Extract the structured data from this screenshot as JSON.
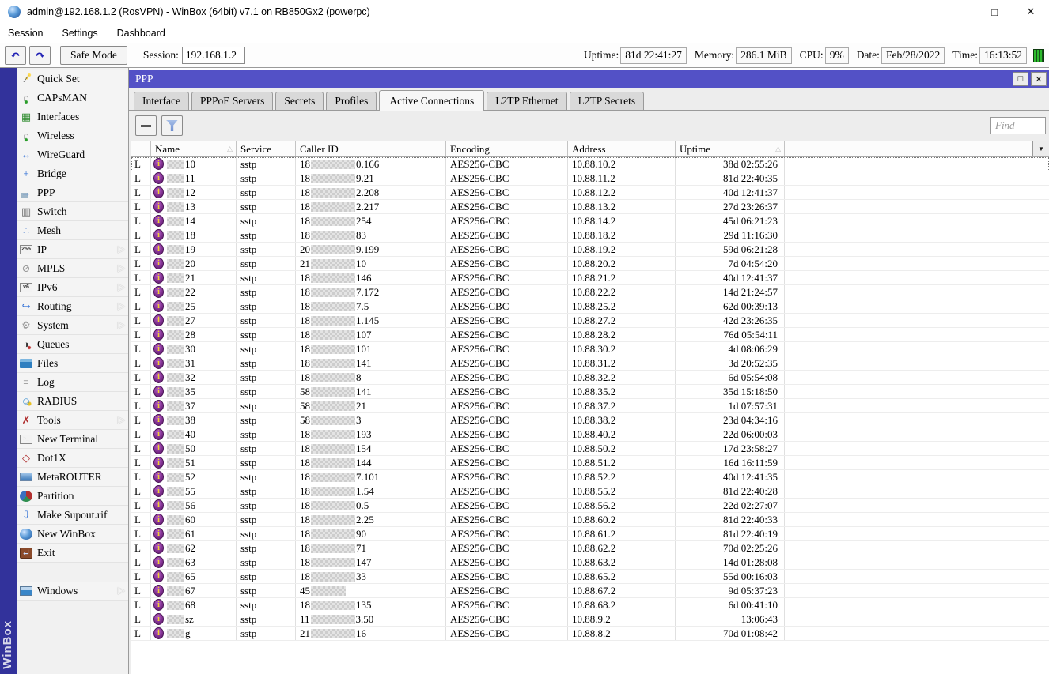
{
  "window": {
    "title": "admin@192.168.1.2 (RosVPN) - WinBox (64bit) v7.1 on RB850Gx2 (powerpc)",
    "controls": {
      "minimize": "–",
      "maximize": "□",
      "close": "✕"
    }
  },
  "menubar": {
    "items": [
      "Session",
      "Settings",
      "Dashboard"
    ]
  },
  "toolbar": {
    "undo_glyph": "↶",
    "redo_glyph": "↷",
    "safe_mode_label": "Safe Mode",
    "session_label": "Session:",
    "session_value": "192.168.1.2",
    "stats": [
      {
        "label": "Uptime:",
        "value": "81d 22:41:27"
      },
      {
        "label": "Memory:",
        "value": "286.1 MiB"
      },
      {
        "label": "CPU:",
        "value": "9%"
      },
      {
        "label": "Date:",
        "value": "Feb/28/2022"
      },
      {
        "label": "Time:",
        "value": "16:13:52"
      }
    ],
    "indicator_color": "#2dbb2d"
  },
  "sidebar": {
    "brand": "WinBox",
    "strip_color": "#32329b",
    "items": [
      {
        "label": "Quick Set",
        "icon": "wand-icon",
        "glyph": "∕",
        "color": "#444444",
        "arrow": false
      },
      {
        "label": "CAPsMAN",
        "icon": "antenna-icon",
        "glyph": "∩",
        "color": "#9a9a9a",
        "arrow": false
      },
      {
        "label": "Interfaces",
        "icon": "nic-icon",
        "glyph": "▦",
        "color": "#2e8b2e",
        "arrow": false
      },
      {
        "label": "Wireless",
        "icon": "antenna-icon",
        "glyph": "∩",
        "color": "#9a9a9a",
        "arrow": false
      },
      {
        "label": "WireGuard",
        "icon": "wireguard-icon",
        "glyph": "↔",
        "color": "#2f6fd6",
        "arrow": false
      },
      {
        "label": "Bridge",
        "icon": "bridge-icon",
        "glyph": "+",
        "color": "#2f6fd6",
        "arrow": false
      },
      {
        "label": "PPP",
        "icon": "ppp-icon",
        "glyph": "→",
        "color": "#2f6fd6",
        "arrow": false
      },
      {
        "label": "Switch",
        "icon": "switch-icon",
        "glyph": "▥",
        "color": "#666666",
        "arrow": false
      },
      {
        "label": "Mesh",
        "icon": "mesh-icon",
        "glyph": "∴",
        "color": "#4477cc",
        "arrow": false
      },
      {
        "label": "IP",
        "icon": "ip-icon",
        "glyph": "255",
        "color": "#333333",
        "boxed": true,
        "arrow": true
      },
      {
        "label": "MPLS",
        "icon": "mpls-icon",
        "glyph": "⊘",
        "color": "#999999",
        "arrow": true
      },
      {
        "label": "IPv6",
        "icon": "ipv6-icon",
        "glyph": "v6",
        "color": "#333333",
        "boxed": true,
        "arrow": true
      },
      {
        "label": "Routing",
        "icon": "routing-icon",
        "glyph": "↪",
        "color": "#2f6fd6",
        "arrow": true
      },
      {
        "label": "System",
        "icon": "system-icon",
        "glyph": "⚙",
        "color": "#9a9a9a",
        "arrow": true
      },
      {
        "label": "Queues",
        "icon": "queues-icon",
        "glyph": "◑",
        "color": "#333333",
        "arrow": false
      },
      {
        "label": "Files",
        "icon": "files-icon",
        "glyph": "",
        "color": "#2f7fc0",
        "arrow": false
      },
      {
        "label": "Log",
        "icon": "log-icon",
        "glyph": "≡",
        "color": "#777777",
        "arrow": false
      },
      {
        "label": "RADIUS",
        "icon": "radius-icon",
        "glyph": "☺",
        "color": "#3a8fd0",
        "arrow": false
      },
      {
        "label": "Tools",
        "icon": "tools-icon",
        "glyph": "✗",
        "color": "#b03030",
        "arrow": true
      },
      {
        "label": "New Terminal",
        "icon": "terminal-icon",
        "glyph": ">_",
        "color": "#e8e8e8",
        "boxed": true,
        "arrow": false
      },
      {
        "label": "Dot1X",
        "icon": "dot1x-icon",
        "glyph": "◇",
        "color": "#b03030",
        "arrow": false
      },
      {
        "label": "MetaROUTER",
        "icon": "metarouter-icon",
        "glyph": "",
        "color": "#3a78b8",
        "arrow": false
      },
      {
        "label": "Partition",
        "icon": "partition-icon",
        "glyph": "",
        "color": "#b23030",
        "arrow": false
      },
      {
        "label": "Make Supout.rif",
        "icon": "supout-icon",
        "glyph": "⇩",
        "color": "#2f6fd6",
        "arrow": false
      },
      {
        "label": "New WinBox",
        "icon": "winbox-icon",
        "glyph": "",
        "color": "#20549a",
        "arrow": false
      },
      {
        "label": "Exit",
        "icon": "exit-icon",
        "glyph": "↵",
        "color": "#cfe0ff",
        "arrow": false
      },
      {
        "spacer": true
      },
      {
        "label": "Windows",
        "icon": "windows-icon",
        "glyph": "",
        "color": "#3a86c8",
        "arrow": true
      }
    ]
  },
  "ppp": {
    "title": "PPP",
    "title_color": "#5351c6",
    "controls": {
      "maximize": "□",
      "close": "✕"
    },
    "tabs": [
      {
        "label": "Interface",
        "active": false
      },
      {
        "label": "PPPoE Servers",
        "active": false
      },
      {
        "label": "Secrets",
        "active": false
      },
      {
        "label": "Profiles",
        "active": false
      },
      {
        "label": "Active Connections",
        "active": true
      },
      {
        "label": "L2TP Ethernet",
        "active": false
      },
      {
        "label": "L2TP Secrets",
        "active": false
      }
    ],
    "find_placeholder": "Find",
    "table": {
      "headers": {
        "flag": "",
        "name": "Name",
        "service": "Service",
        "caller": "Caller ID",
        "encoding": "Encoding",
        "address": "Address",
        "uptime": "Uptime"
      },
      "sort_glyph": "△",
      "dropdown_glyph": "▼",
      "rows": [
        {
          "flag": "L",
          "name_suffix": "10",
          "service": "sstp",
          "caller_prefix": "18",
          "caller_suffix": "0.166",
          "encoding": "AES256-CBC",
          "address": "10.88.10.2",
          "uptime": "38d 02:55:26"
        },
        {
          "flag": "L",
          "name_suffix": "11",
          "service": "sstp",
          "caller_prefix": "18",
          "caller_suffix": "9.21",
          "encoding": "AES256-CBC",
          "address": "10.88.11.2",
          "uptime": "81d 22:40:35"
        },
        {
          "flag": "L",
          "name_suffix": "12",
          "service": "sstp",
          "caller_prefix": "18",
          "caller_suffix": "2.208",
          "encoding": "AES256-CBC",
          "address": "10.88.12.2",
          "uptime": "40d 12:41:37"
        },
        {
          "flag": "L",
          "name_suffix": "13",
          "service": "sstp",
          "caller_prefix": "18",
          "caller_suffix": "2.217",
          "encoding": "AES256-CBC",
          "address": "10.88.13.2",
          "uptime": "27d 23:26:37"
        },
        {
          "flag": "L",
          "name_suffix": "14",
          "service": "sstp",
          "caller_prefix": "18",
          "caller_suffix": "254",
          "encoding": "AES256-CBC",
          "address": "10.88.14.2",
          "uptime": "45d 06:21:23"
        },
        {
          "flag": "L",
          "name_suffix": "18",
          "service": "sstp",
          "caller_prefix": "18",
          "caller_suffix": "83",
          "encoding": "AES256-CBC",
          "address": "10.88.18.2",
          "uptime": "29d 11:16:30"
        },
        {
          "flag": "L",
          "name_suffix": "19",
          "service": "sstp",
          "caller_prefix": "20",
          "caller_suffix": "9.199",
          "encoding": "AES256-CBC",
          "address": "10.88.19.2",
          "uptime": "59d 06:21:28"
        },
        {
          "flag": "L",
          "name_suffix": "20",
          "service": "sstp",
          "caller_prefix": "21",
          "caller_suffix": "10",
          "encoding": "AES256-CBC",
          "address": "10.88.20.2",
          "uptime": "7d 04:54:20"
        },
        {
          "flag": "L",
          "name_suffix": "21",
          "service": "sstp",
          "caller_prefix": "18",
          "caller_suffix": "146",
          "encoding": "AES256-CBC",
          "address": "10.88.21.2",
          "uptime": "40d 12:41:37"
        },
        {
          "flag": "L",
          "name_suffix": "22",
          "service": "sstp",
          "caller_prefix": "18",
          "caller_suffix": "7.172",
          "encoding": "AES256-CBC",
          "address": "10.88.22.2",
          "uptime": "14d 21:24:57"
        },
        {
          "flag": "L",
          "name_suffix": "25",
          "service": "sstp",
          "caller_prefix": "18",
          "caller_suffix": "7.5",
          "encoding": "AES256-CBC",
          "address": "10.88.25.2",
          "uptime": "62d 00:39:13"
        },
        {
          "flag": "L",
          "name_suffix": "27",
          "service": "sstp",
          "caller_prefix": "18",
          "caller_suffix": "1.145",
          "encoding": "AES256-CBC",
          "address": "10.88.27.2",
          "uptime": "42d 23:26:35"
        },
        {
          "flag": "L",
          "name_suffix": "28",
          "service": "sstp",
          "caller_prefix": "18",
          "caller_suffix": "107",
          "encoding": "AES256-CBC",
          "address": "10.88.28.2",
          "uptime": "76d 05:54:11"
        },
        {
          "flag": "L",
          "name_suffix": "30",
          "service": "sstp",
          "caller_prefix": "18",
          "caller_suffix": "101",
          "encoding": "AES256-CBC",
          "address": "10.88.30.2",
          "uptime": "4d 08:06:29"
        },
        {
          "flag": "L",
          "name_suffix": "31",
          "service": "sstp",
          "caller_prefix": "18",
          "caller_suffix": "141",
          "encoding": "AES256-CBC",
          "address": "10.88.31.2",
          "uptime": "3d 20:52:35"
        },
        {
          "flag": "L",
          "name_suffix": "32",
          "service": "sstp",
          "caller_prefix": "18",
          "caller_suffix": "8",
          "encoding": "AES256-CBC",
          "address": "10.88.32.2",
          "uptime": "6d 05:54:08"
        },
        {
          "flag": "L",
          "name_suffix": "35",
          "service": "sstp",
          "caller_prefix": "58",
          "caller_suffix": "141",
          "encoding": "AES256-CBC",
          "address": "10.88.35.2",
          "uptime": "35d 15:18:50"
        },
        {
          "flag": "L",
          "name_suffix": "37",
          "service": "sstp",
          "caller_prefix": "58",
          "caller_suffix": "21",
          "encoding": "AES256-CBC",
          "address": "10.88.37.2",
          "uptime": "1d 07:57:31"
        },
        {
          "flag": "L",
          "name_suffix": "38",
          "service": "sstp",
          "caller_prefix": "58",
          "caller_suffix": "3",
          "encoding": "AES256-CBC",
          "address": "10.88.38.2",
          "uptime": "23d 04:34:16"
        },
        {
          "flag": "L",
          "name_suffix": "40",
          "service": "sstp",
          "caller_prefix": "18",
          "caller_suffix": "193",
          "encoding": "AES256-CBC",
          "address": "10.88.40.2",
          "uptime": "22d 06:00:03"
        },
        {
          "flag": "L",
          "name_suffix": "50",
          "service": "sstp",
          "caller_prefix": "18",
          "caller_suffix": "154",
          "encoding": "AES256-CBC",
          "address": "10.88.50.2",
          "uptime": "17d 23:58:27"
        },
        {
          "flag": "L",
          "name_suffix": "51",
          "service": "sstp",
          "caller_prefix": "18",
          "caller_suffix": "144",
          "encoding": "AES256-CBC",
          "address": "10.88.51.2",
          "uptime": "16d 16:11:59"
        },
        {
          "flag": "L",
          "name_suffix": "52",
          "service": "sstp",
          "caller_prefix": "18",
          "caller_suffix": "7.101",
          "encoding": "AES256-CBC",
          "address": "10.88.52.2",
          "uptime": "40d 12:41:35"
        },
        {
          "flag": "L",
          "name_suffix": "55",
          "service": "sstp",
          "caller_prefix": "18",
          "caller_suffix": "1.54",
          "encoding": "AES256-CBC",
          "address": "10.88.55.2",
          "uptime": "81d 22:40:28"
        },
        {
          "flag": "L",
          "name_suffix": "56",
          "service": "sstp",
          "caller_prefix": "18",
          "caller_suffix": "0.5",
          "encoding": "AES256-CBC",
          "address": "10.88.56.2",
          "uptime": "22d 02:27:07"
        },
        {
          "flag": "L",
          "name_suffix": "60",
          "service": "sstp",
          "caller_prefix": "18",
          "caller_suffix": "2.25",
          "encoding": "AES256-CBC",
          "address": "10.88.60.2",
          "uptime": "81d 22:40:33"
        },
        {
          "flag": "L",
          "name_suffix": "61",
          "service": "sstp",
          "caller_prefix": "18",
          "caller_suffix": "90",
          "encoding": "AES256-CBC",
          "address": "10.88.61.2",
          "uptime": "81d 22:40:19"
        },
        {
          "flag": "L",
          "name_suffix": "62",
          "service": "sstp",
          "caller_prefix": "18",
          "caller_suffix": "71",
          "encoding": "AES256-CBC",
          "address": "10.88.62.2",
          "uptime": "70d 02:25:26"
        },
        {
          "flag": "L",
          "name_suffix": "63",
          "service": "sstp",
          "caller_prefix": "18",
          "caller_suffix": "147",
          "encoding": "AES256-CBC",
          "address": "10.88.63.2",
          "uptime": "14d 01:28:08"
        },
        {
          "flag": "L",
          "name_suffix": "65",
          "service": "sstp",
          "caller_prefix": "18",
          "caller_suffix": "33",
          "encoding": "AES256-CBC",
          "address": "10.88.65.2",
          "uptime": "55d 00:16:03"
        },
        {
          "flag": "L",
          "name_suffix": "67",
          "service": "sstp",
          "caller_prefix": "45",
          "caller_suffix": "",
          "encoding": "AES256-CBC",
          "address": "10.88.67.2",
          "uptime": "9d 05:37:23"
        },
        {
          "flag": "L",
          "name_suffix": "68",
          "service": "sstp",
          "caller_prefix": "18",
          "caller_suffix": "135",
          "encoding": "AES256-CBC",
          "address": "10.88.68.2",
          "uptime": "6d 00:41:10"
        },
        {
          "flag": "L",
          "name_suffix": "sz",
          "service": "sstp",
          "caller_prefix": "11",
          "caller_suffix": "3.50",
          "encoding": "AES256-CBC",
          "address": "10.88.9.2",
          "uptime": "13:06:43"
        },
        {
          "flag": "L",
          "name_suffix": "g",
          "service": "sstp",
          "caller_prefix": "21",
          "caller_suffix": "16",
          "encoding": "AES256-CBC",
          "address": "10.88.8.2",
          "uptime": "70d 01:08:42"
        }
      ]
    }
  }
}
